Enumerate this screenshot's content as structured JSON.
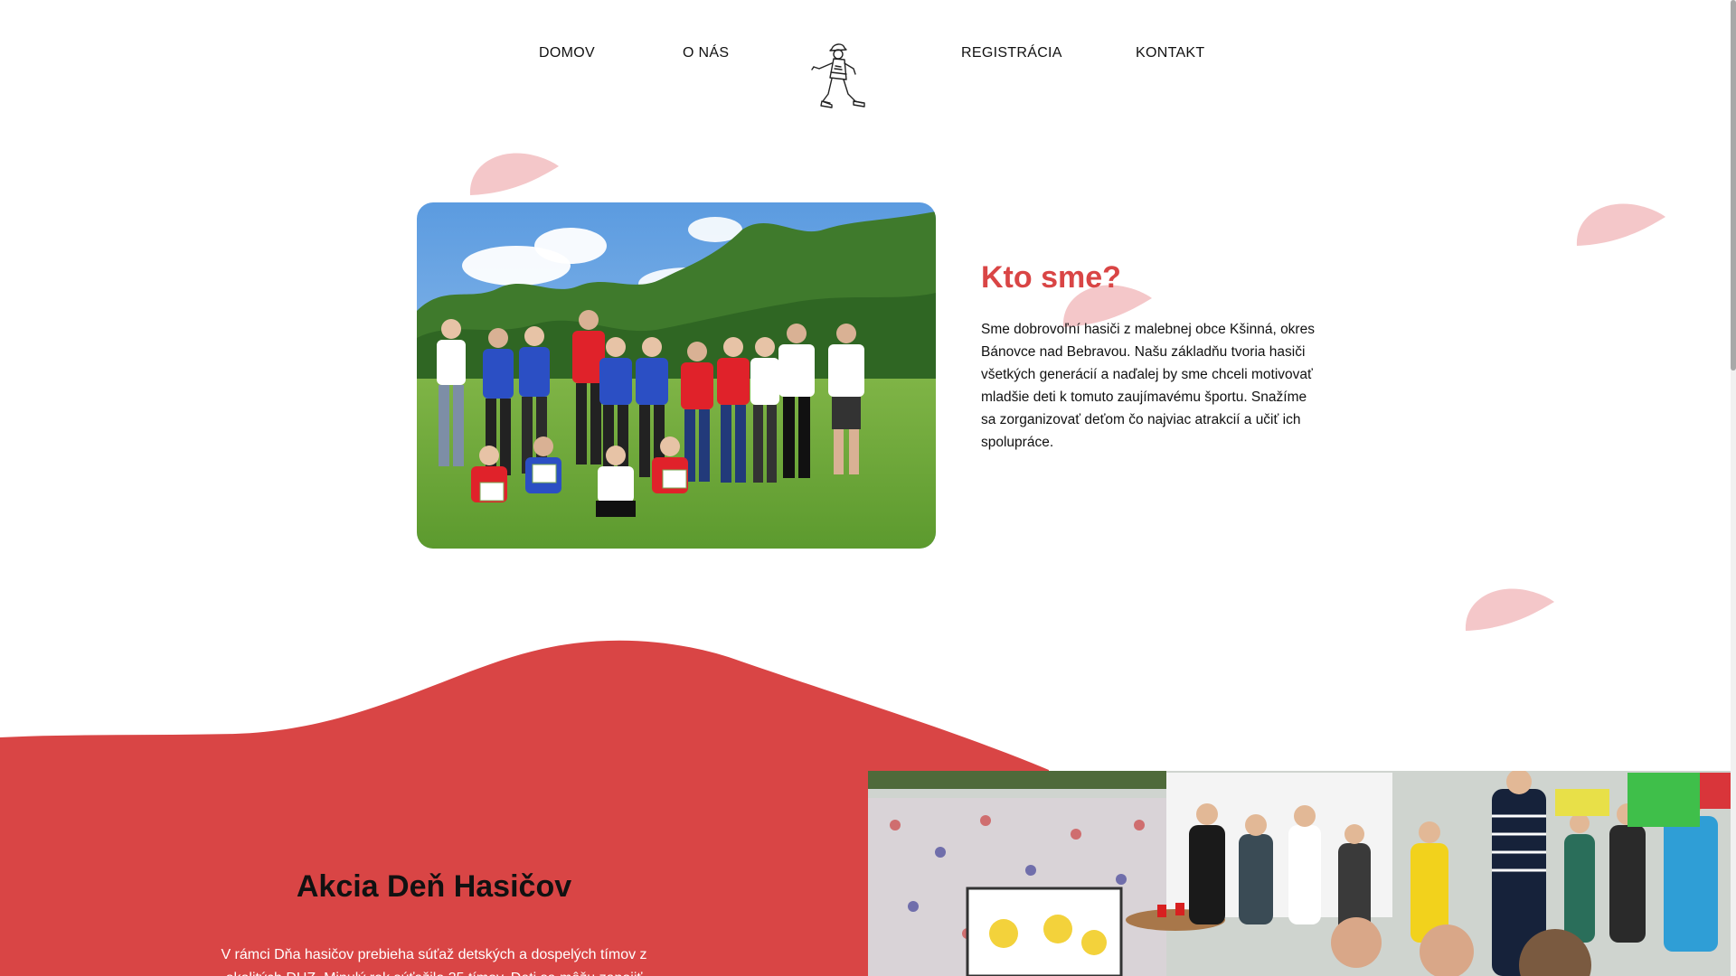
{
  "nav": {
    "items": [
      {
        "label": "DOMOV"
      },
      {
        "label": "O NÁS"
      },
      {
        "label": "REGISTRÁCIA"
      },
      {
        "label": "KONTAKT"
      }
    ],
    "logo_icon": "firefighter-logo-icon"
  },
  "about": {
    "title": "Kto sme?",
    "text": "Sme dobrovoľní hasiči z malebnej obce Kšinná, okres Bánovce nad Bebravou. Našu základňu tvoria hasiči všetkých generácií a naďalej by sme chceli motivovať mladšie deti k tomuto zaujímavému športu. Snažíme sa zorganizovať deťom čo najviac atrakcií a učiť ich spolupráce."
  },
  "event": {
    "title": "Akcia Deň Hasičov",
    "text": "V rámci Dňa hasičov prebieha súťaž detských a dospelých tímov z okolitých DHZ. Minulý rok súťažilo 35 tímov. Deti sa môžu zapojiť"
  },
  "colors": {
    "accent": "#d94545",
    "petal": "#f4c7c9",
    "text": "#111111"
  }
}
